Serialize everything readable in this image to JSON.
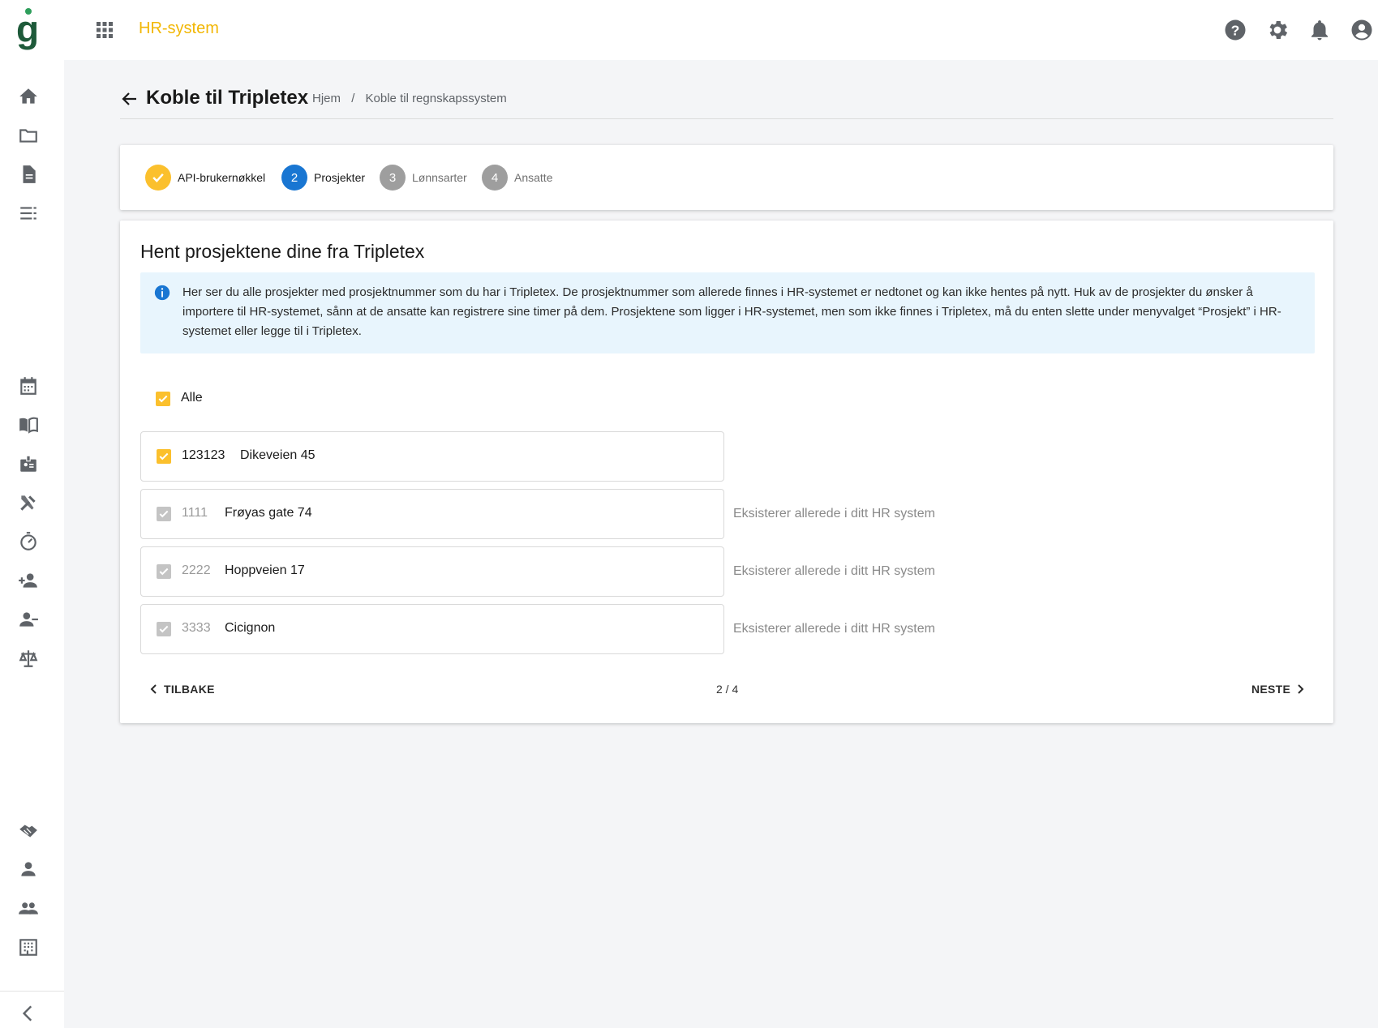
{
  "app": {
    "title": "HR-system",
    "brand_color": "#f2b705",
    "logo_letter": "g",
    "logo_color": "#1e5a3a"
  },
  "topbar_icons": [
    "help-icon",
    "settings-icon",
    "notifications-icon",
    "account-icon"
  ],
  "sidebar": {
    "items": [
      {
        "name": "home-icon"
      },
      {
        "name": "folder-icon"
      },
      {
        "name": "document-icon"
      },
      {
        "name": "list-icon"
      },
      {
        "name": "calendar-icon"
      },
      {
        "name": "book-icon"
      },
      {
        "name": "badge-icon"
      },
      {
        "name": "tools-icon"
      },
      {
        "name": "timer-icon"
      },
      {
        "name": "person-add-icon"
      },
      {
        "name": "person-remove-icon"
      },
      {
        "name": "scale-icon"
      },
      {
        "name": "handshake-icon"
      },
      {
        "name": "person-icon"
      },
      {
        "name": "group-icon"
      },
      {
        "name": "building-icon"
      }
    ],
    "collapse_icon": "chevron-left-icon"
  },
  "header": {
    "title": "Koble til Tripletex",
    "breadcrumb": [
      "Hjem",
      "Koble til regnskapssystem"
    ],
    "breadcrumb_separator": "/"
  },
  "stepper": {
    "steps": [
      {
        "label": "API-brukernøkkel",
        "number": "",
        "state": "done"
      },
      {
        "label": "Prosjekter",
        "number": "2",
        "state": "active"
      },
      {
        "label": "Lønnsarter",
        "number": "3",
        "state": "pending"
      },
      {
        "label": "Ansatte",
        "number": "4",
        "state": "pending"
      }
    ],
    "colors": {
      "done": "#fbc02d",
      "active": "#1976d2",
      "pending": "#9e9e9e"
    }
  },
  "main": {
    "title": "Hent prosjektene dine fra Tripletex",
    "info_text": "Her ser du alle prosjekter med prosjektnummer som du har i Tripletex. De prosjektnummer som allerede finnes i HR-systemet er nedtonet og kan ikke hentes på nytt. Huk av de prosjekter du ønsker å importere til HR-systemet, sånn at de ansatte kan registrere sine timer på dem. Prosjektene som ligger i HR-systemet, men som ikke finnes i Tripletex, må du enten slette under menyvalget “Prosjekt” i HR-systemet eller legge til i Tripletex.",
    "select_all_label": "Alle",
    "projects": [
      {
        "number": "123123",
        "name": "Dikeveien 45",
        "checked": true,
        "disabled": false,
        "note": ""
      },
      {
        "number": "1111",
        "name": "Frøyas gate 74",
        "checked": true,
        "disabled": true,
        "note": "Eksisterer allerede i ditt HR system"
      },
      {
        "number": "2222",
        "name": "Hoppveien 17",
        "checked": true,
        "disabled": true,
        "note": "Eksisterer allerede i ditt HR system"
      },
      {
        "number": "3333",
        "name": "Cicignon",
        "checked": true,
        "disabled": true,
        "note": "Eksisterer allerede i ditt HR system"
      }
    ],
    "back_label": "TILBAKE",
    "next_label": "NESTE",
    "page_indicator": "2 / 4"
  }
}
